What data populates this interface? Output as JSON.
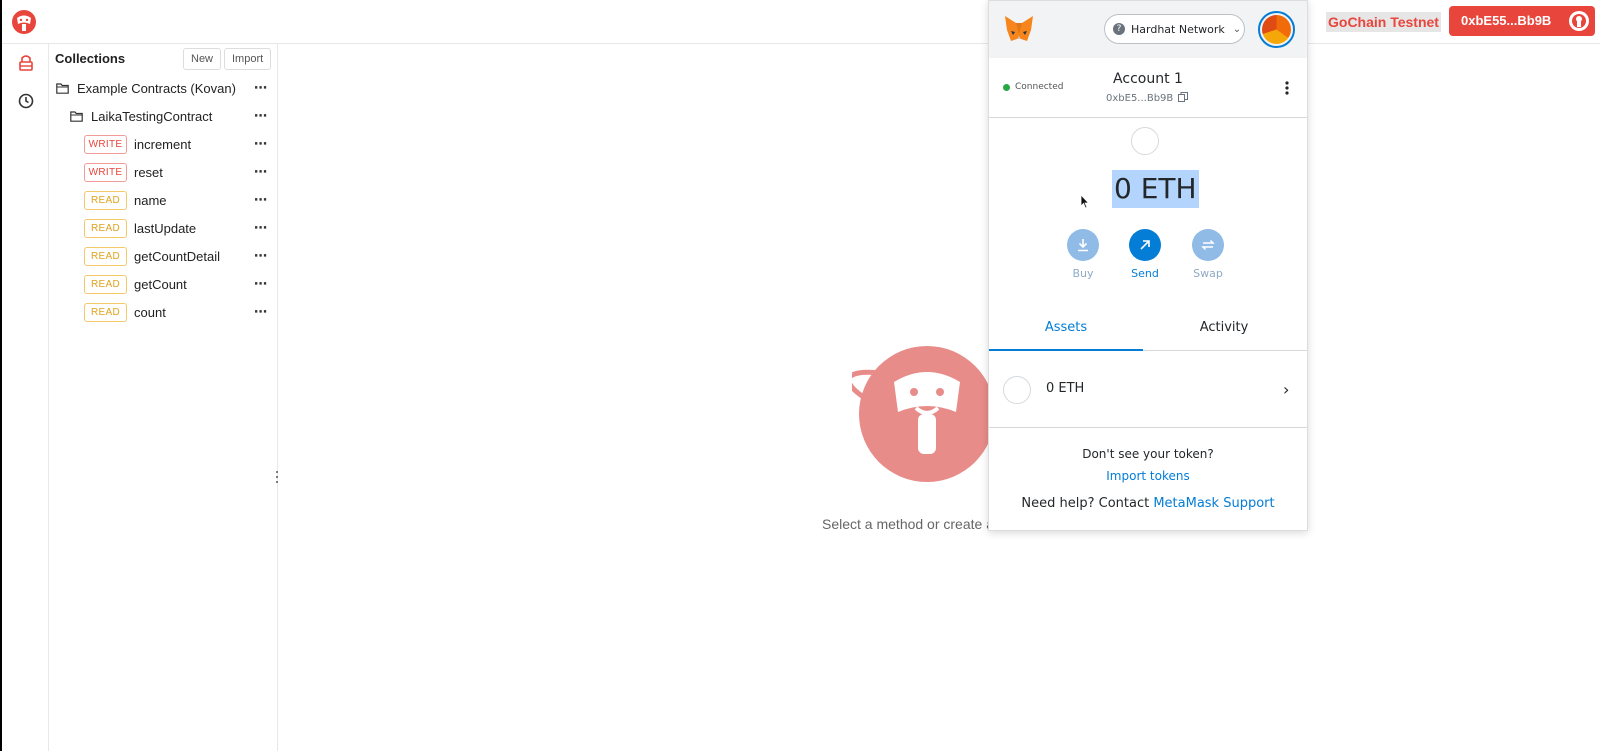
{
  "topbar": {
    "network": "GoChain Testnet",
    "address": "0xbE55...Bb9B"
  },
  "collections": {
    "title": "Collections",
    "new_label": "New",
    "import_label": "Import",
    "folder": "Example Contracts (Kovan)",
    "contract": "LaikaTestingContract",
    "methods": [
      {
        "type": "WRITE",
        "name": "increment"
      },
      {
        "type": "WRITE",
        "name": "reset"
      },
      {
        "type": "READ",
        "name": "name"
      },
      {
        "type": "READ",
        "name": "lastUpdate"
      },
      {
        "type": "READ",
        "name": "getCountDetail"
      },
      {
        "type": "READ",
        "name": "getCount"
      },
      {
        "type": "READ",
        "name": "count"
      }
    ],
    "more": "⋯"
  },
  "main": {
    "empty_text": "Select a method or create a new one!"
  },
  "metamask": {
    "network": "Hardhat Network",
    "connected": "Connected",
    "account_name": "Account 1",
    "account_address": "0xbE5...Bb9B",
    "balance": "0 ETH",
    "actions": {
      "buy": "Buy",
      "send": "Send",
      "swap": "Swap"
    },
    "tabs": {
      "assets": "Assets",
      "activity": "Activity"
    },
    "asset_row": "0 ETH",
    "dont_see": "Don't see your token?",
    "import_tokens": "Import tokens",
    "help_prefix": "Need help? Contact ",
    "support_link": "MetaMask Support"
  },
  "colors": {
    "brand": "#e8453c",
    "write": "#e8453c",
    "read": "#e0a21f",
    "mm_accent": "#037dd6"
  }
}
